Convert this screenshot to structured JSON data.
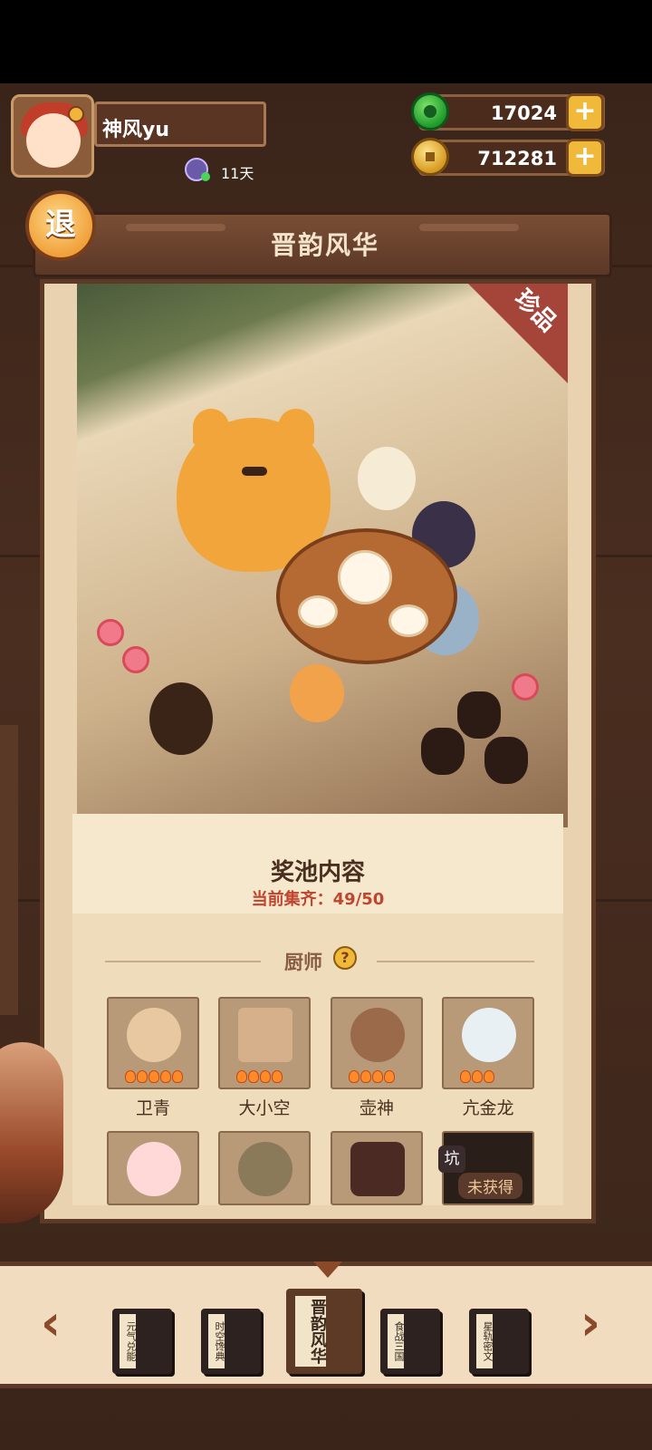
{
  "player": {
    "name": "神风yu",
    "days": "11天"
  },
  "resources": {
    "jade": "17024",
    "coins": "712281"
  },
  "header": {
    "exit_label": "退",
    "title": "晋韵风华"
  },
  "banner": {
    "rarity_badge": "珍品"
  },
  "pool": {
    "title": "奖池内容",
    "progress_text": "当前集齐：49/50"
  },
  "section": {
    "title": "厨师",
    "help_icon": "?"
  },
  "chefs": [
    {
      "name": "卫青",
      "color": "#e8c8a0",
      "flames": 5
    },
    {
      "name": "大小空",
      "color": "#d6b08a",
      "flames": 4
    },
    {
      "name": "壶神",
      "color": "#9a6a4a",
      "flames": 4
    },
    {
      "name": "亢金龙",
      "color": "#e8f0f4",
      "flames": 3
    },
    {
      "name": "",
      "color": "#ffd8d8",
      "flames": 0
    },
    {
      "name": "",
      "color": "#8a7a5a",
      "flames": 0
    },
    {
      "name": "",
      "color": "#4a2a22",
      "flames": 0
    },
    {
      "name": "",
      "color": "#2a1e18",
      "flames": 0,
      "locked_label": "未获得",
      "badge": "坑"
    }
  ],
  "themes": [
    {
      "label": "元气兑能",
      "active": false
    },
    {
      "label": "时空馋典",
      "active": false
    },
    {
      "label": "晋韵风华",
      "active": true
    },
    {
      "label": "食战三国",
      "active": false
    },
    {
      "label": "星轨密文",
      "active": false
    }
  ],
  "nav": {
    "prev": "‹",
    "next": "›"
  },
  "icons": [
    "jade-icon",
    "coin-icon",
    "plus-icon",
    "exit-icon",
    "question-icon",
    "chevron-left-icon",
    "chevron-right-icon"
  ]
}
